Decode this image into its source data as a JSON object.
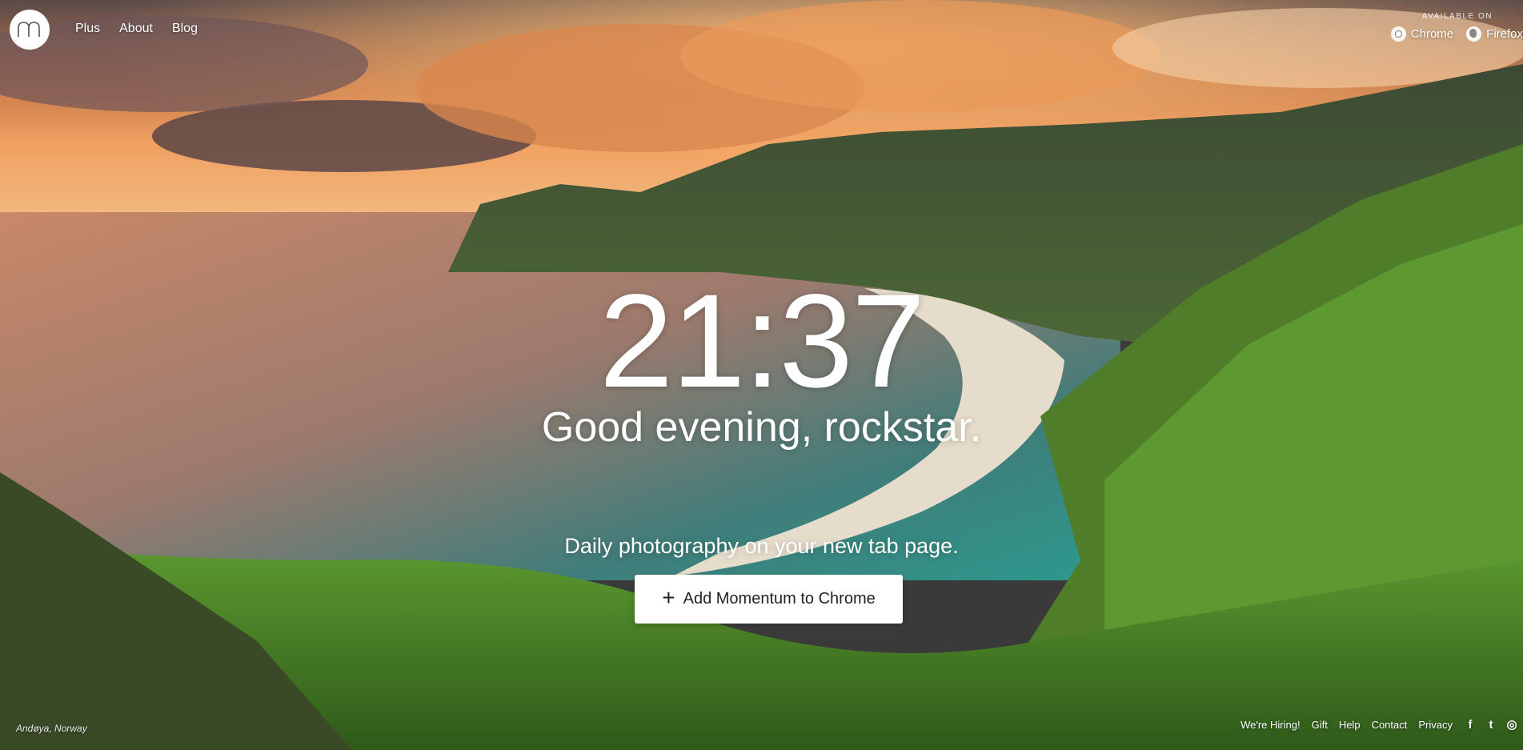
{
  "nav": {
    "links": [
      "Plus",
      "About",
      "Blog"
    ]
  },
  "availability": {
    "label": "AVAILABLE ON",
    "browsers": [
      {
        "name": "Chrome",
        "icon": "chrome-icon"
      },
      {
        "name": "Firefox",
        "icon": "firefox-icon"
      }
    ]
  },
  "main": {
    "time": "21:37",
    "greeting": "Good evening, rockstar.",
    "tagline": "Daily photography on your new tab page.",
    "cta_icon": "+",
    "cta_label": "Add Momentum to Chrome"
  },
  "photo": {
    "location": "Andøya, Norway"
  },
  "footer": {
    "links": [
      "We're Hiring!",
      "Gift",
      "Help",
      "Contact",
      "Privacy"
    ],
    "social": [
      {
        "icon": "facebook-icon",
        "glyph": "f"
      },
      {
        "icon": "twitter-icon",
        "glyph": "t"
      },
      {
        "icon": "instagram-icon",
        "glyph": "◎"
      }
    ]
  }
}
